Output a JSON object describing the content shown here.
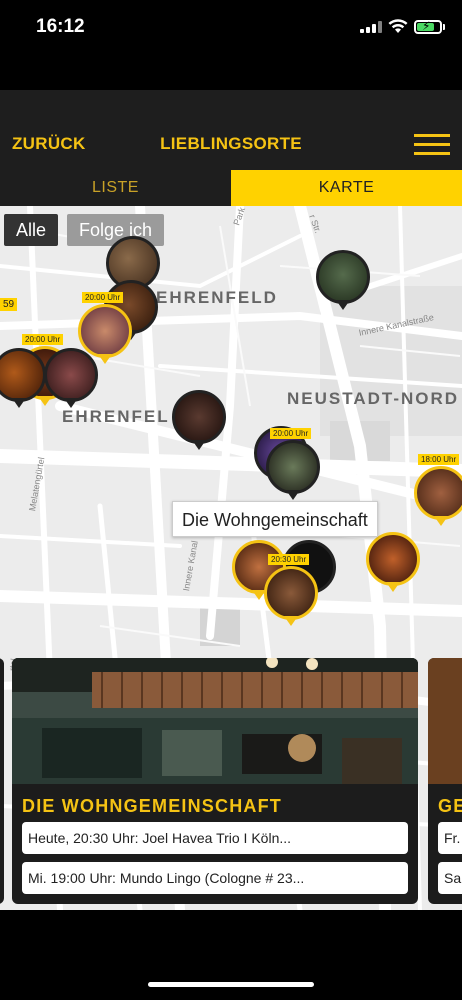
{
  "status_bar": {
    "time": "16:12"
  },
  "header": {
    "back_label": "ZURÜCK",
    "title": "LIEBLINGSORTE"
  },
  "tabs": [
    {
      "label": "LISTE",
      "active": false
    },
    {
      "label": "KARTE",
      "active": true
    }
  ],
  "filters": [
    {
      "label": "Alle",
      "active": true
    },
    {
      "label": "Folge ich",
      "active": false
    }
  ],
  "map": {
    "labels": [
      "EHRENFELD",
      "EHRENFEL",
      "NEUSTADT-NORD"
    ],
    "streets": [
      "Innere Kanalstraße",
      "Melatengürtel",
      "Innere Kanal",
      "Park",
      "r Str.",
      "rtel"
    ],
    "small_badge": "59",
    "pins": [
      {
        "badge": "20:00 Uhr",
        "highlighted": true
      },
      {
        "badge": "20:00 Uhr",
        "highlighted": true
      },
      {
        "badge": "20:00 Uhr",
        "highlighted": false
      },
      {
        "badge": "18:00 Uhr",
        "highlighted": true
      },
      {
        "badge": "20:30 Uhr",
        "highlighted": true
      }
    ],
    "tooltip": "Die Wohngemeinschaft"
  },
  "cards": [
    {
      "name": "DIE WOHNGEMEINSCHAFT",
      "events": [
        "Heute, 20:30 Uhr: Joel Havea Trio I Köln...",
        "Mi. 19:00 Uhr: Mundo Lingo (Cologne # 23..."
      ]
    },
    {
      "name": "GE",
      "events": [
        "Fr.",
        "Sa."
      ]
    }
  ],
  "colors": {
    "accent": "#f5c314",
    "tab_active_bg": "#ffd200",
    "header_bg": "#1e1e1e"
  }
}
